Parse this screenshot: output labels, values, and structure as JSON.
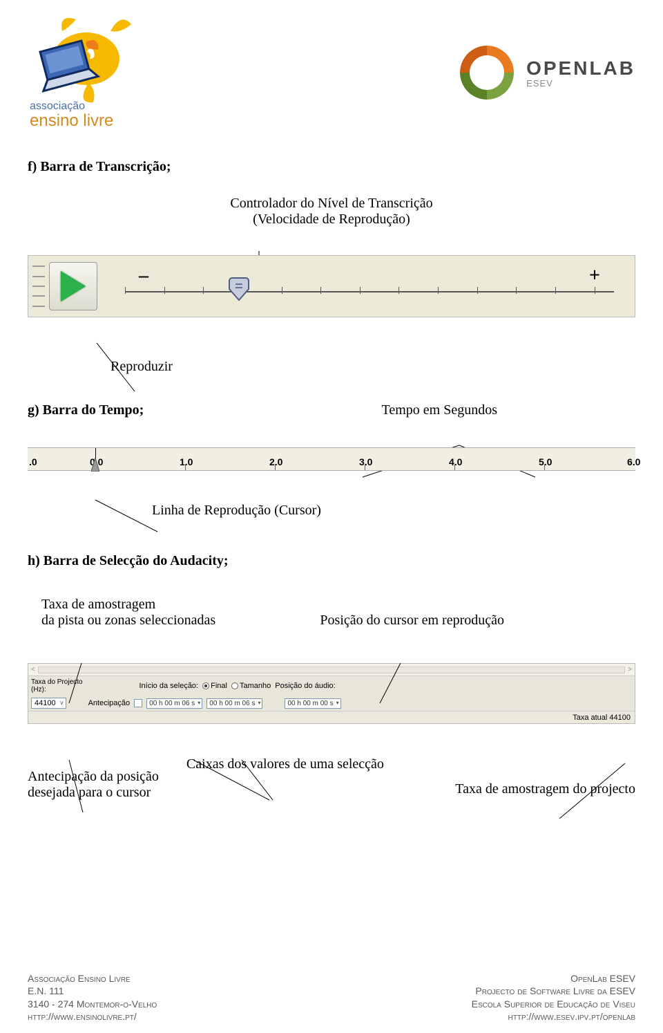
{
  "header": {
    "left_logo_top": "associação",
    "left_logo_bottom": "ensino livre",
    "right_logo_title": "OPENLAB",
    "right_logo_sub": "ESEV"
  },
  "sec_f": {
    "title": "f) Barra de Transcrição;",
    "controller_label_l1": "Controlador do Nível de Transcrição",
    "controller_label_l2": "(Velocidade de Reprodução)",
    "minus": "–",
    "plus": "+",
    "reproduzir": "Reproduzir"
  },
  "sec_g": {
    "title": "g) Barra do Tempo;",
    "right_label": "Tempo em Segundos",
    "ticks": [
      ".0",
      "0,0",
      "1.0",
      "2.0",
      "3.0",
      "4.0",
      "5.0",
      "6.0"
    ],
    "cursor_label": "Linha de Reprodução (Cursor)"
  },
  "sec_h": {
    "title": "h) Barra de Selecção do Audacity;",
    "left_caption_l1": "Taxa de amostragem",
    "left_caption_l2": "da pista ou zonas seleccionadas",
    "right_caption": "Posição do cursor em reprodução",
    "taxa_proj_l1": "Taxa do Projecto",
    "taxa_proj_l2": "(Hz):",
    "taxa_value": "44100",
    "antecipacao": "Antecipação",
    "inicio": "Início da seleção:",
    "final": "Final",
    "tamanho": "Tamanho",
    "posicao_audio": "Posição do áudio:",
    "time1": "00 h 00 m 06 s",
    "time2": "00 h 00 m 06 s",
    "time3": "00 h 00 m 00 s",
    "taxa_atual": "Taxa atual 44100",
    "bottom_left_l1": "Antecipação da posição",
    "bottom_left_l2": "desejada para o cursor",
    "bottom_mid": "Caixas dos valores de uma selecção",
    "bottom_right": "Taxa de amostragem do projecto"
  },
  "footer": {
    "l1": "Associação Ensino Livre",
    "l2": "E.N. 111",
    "l3": "3140 - 274 Montemor-o-Velho",
    "l4": "http://www.ensinolivre.pt/",
    "r1": "OpenLab ESEV",
    "r2": "Projecto de Software Livre da ESEV",
    "r3": "Escola Superior de Educação de Viseu",
    "r4": "http://www.esev.ipv.pt/openlab"
  }
}
